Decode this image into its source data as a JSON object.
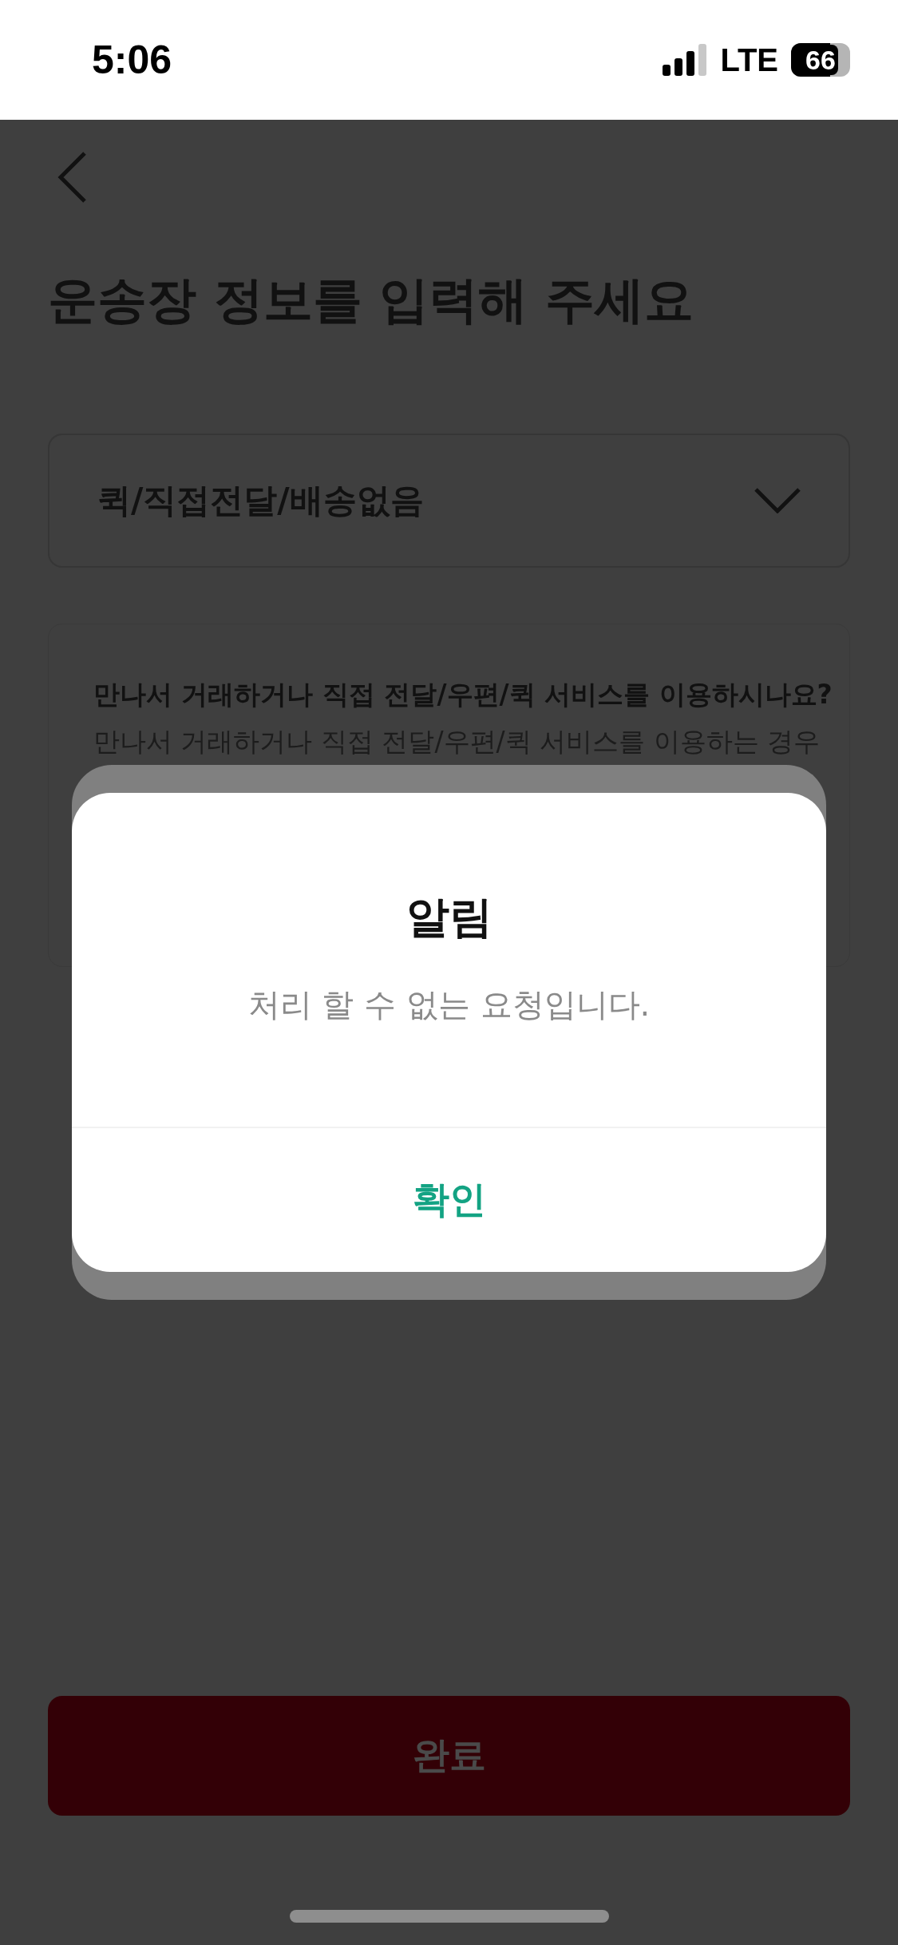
{
  "status_bar": {
    "time": "5:06",
    "network": "LTE",
    "battery": {
      "text": "66",
      "level": 0.66
    }
  },
  "page": {
    "title": "운송장 정보를 입력해 주세요",
    "dropdown": {
      "value": "퀵/직접전달/배송없음",
      "expanded": false
    },
    "info": {
      "heading": "만나서 거래하거나 직접 전달/우편/퀵 서비스를 이용하시나요?",
      "body": "만나서 거래하거나 직접 전달/우편/퀵 서비스를 이용하는 경우"
    },
    "complete_button": {
      "label": "완료"
    }
  },
  "dialog": {
    "title": "알림",
    "message": "처리 할 수 없는 요청입니다.",
    "buttons": [
      {
        "label": "확인"
      }
    ]
  }
}
